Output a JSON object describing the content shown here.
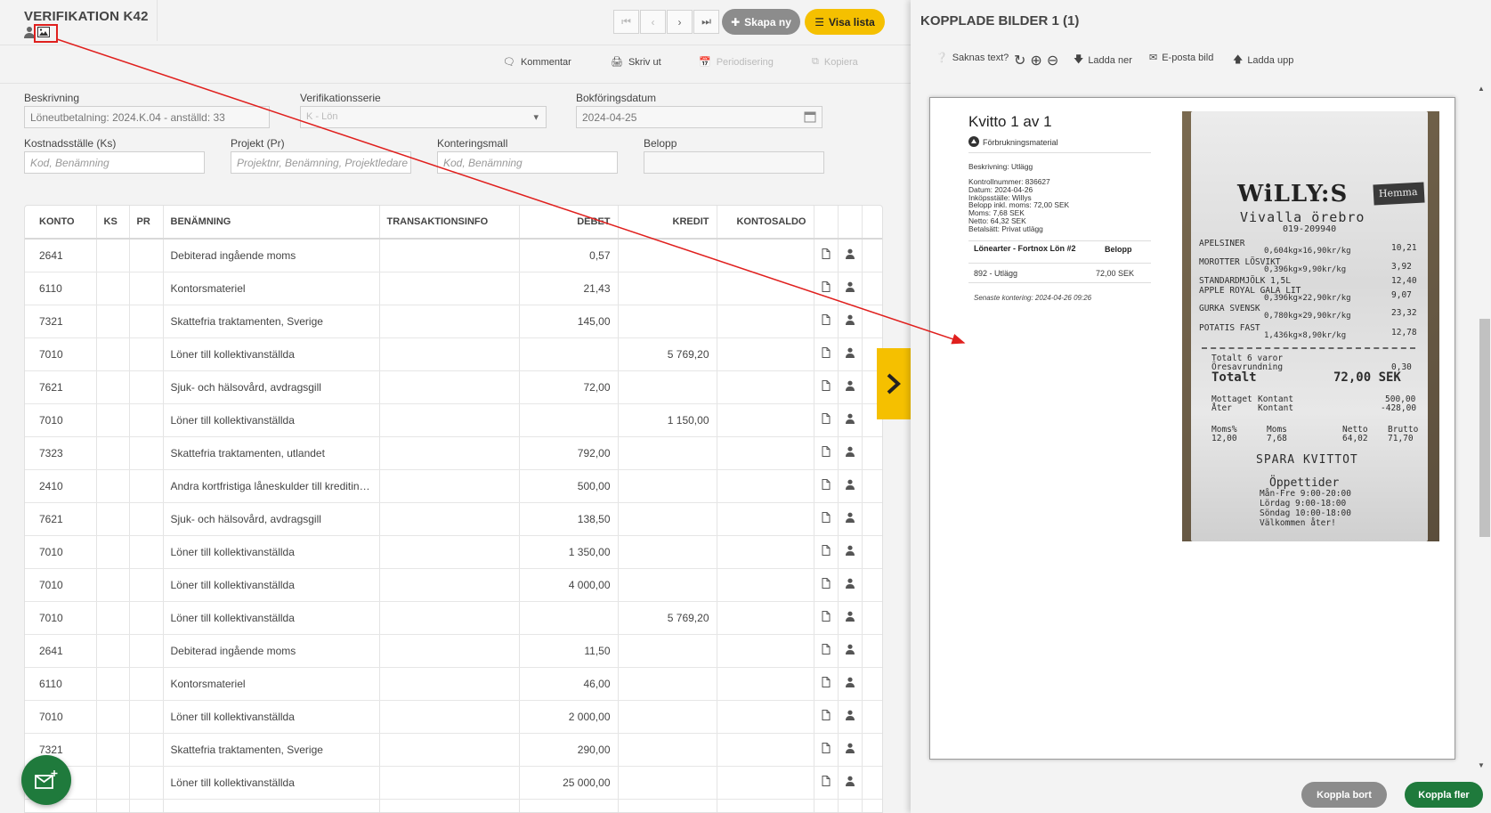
{
  "header": {
    "title": "VERIFIKATION K42",
    "skapa_label": "Skapa ny",
    "visa_label": "Visa lista"
  },
  "actions": {
    "kommentar": "Kommentar",
    "skriv_ut": "Skriv ut",
    "periodisering": "Periodisering",
    "kopiera": "Kopiera"
  },
  "form": {
    "beskrivning_label": "Beskrivning",
    "beskrivning_value": "Löneutbetalning: 2024.K.04 - anställd: 33",
    "serie_label": "Verifikationsserie",
    "serie_value": "K - Lön",
    "datum_label": "Bokföringsdatum",
    "datum_value": "2024-04-25",
    "ks_label": "Kostnadsställe (Ks)",
    "ks_placeholder": "Kod, Benämning",
    "pr_label": "Projekt (Pr)",
    "pr_placeholder": "Projektnr, Benämning, Projektledare",
    "mall_label": "Konteringsmall",
    "mall_placeholder": "Kod, Benämning",
    "belopp_label": "Belopp",
    "belopp_value": ""
  },
  "table": {
    "headers": [
      "KONTO",
      "KS",
      "PR",
      "BENÄMNING",
      "TRANSAKTIONSINFO",
      "DEBET",
      "KREDIT",
      "KONTOSALDO"
    ],
    "rows": [
      {
        "konto": "2641",
        "benamning": "Debiterad ingående moms",
        "debet": "0,57",
        "kredit": ""
      },
      {
        "konto": "6110",
        "benamning": "Kontorsmateriel",
        "debet": "21,43",
        "kredit": ""
      },
      {
        "konto": "7321",
        "benamning": "Skattefria traktamenten, Sverige",
        "debet": "145,00",
        "kredit": ""
      },
      {
        "konto": "7010",
        "benamning": "Löner till kollektivanställda",
        "debet": "",
        "kredit": "5 769,20"
      },
      {
        "konto": "7621",
        "benamning": "Sjuk- och hälsovård, avdragsgill",
        "debet": "72,00",
        "kredit": ""
      },
      {
        "konto": "7010",
        "benamning": "Löner till kollektivanställda",
        "debet": "",
        "kredit": "1 150,00"
      },
      {
        "konto": "7323",
        "benamning": "Skattefria traktamenten, utlandet",
        "debet": "792,00",
        "kredit": ""
      },
      {
        "konto": "2410",
        "benamning": "Andra kortfristiga låneskulder till kreditinstitut",
        "debet": "500,00",
        "kredit": ""
      },
      {
        "konto": "7621",
        "benamning": "Sjuk- och hälsovård, avdragsgill",
        "debet": "138,50",
        "kredit": ""
      },
      {
        "konto": "7010",
        "benamning": "Löner till kollektivanställda",
        "debet": "1 350,00",
        "kredit": ""
      },
      {
        "konto": "7010",
        "benamning": "Löner till kollektivanställda",
        "debet": "4 000,00",
        "kredit": ""
      },
      {
        "konto": "7010",
        "benamning": "Löner till kollektivanställda",
        "debet": "",
        "kredit": "5 769,20"
      },
      {
        "konto": "2641",
        "benamning": "Debiterad ingående moms",
        "debet": "11,50",
        "kredit": ""
      },
      {
        "konto": "6110",
        "benamning": "Kontorsmateriel",
        "debet": "46,00",
        "kredit": ""
      },
      {
        "konto": "7010",
        "benamning": "Löner till kollektivanställda",
        "debet": "2 000,00",
        "kredit": ""
      },
      {
        "konto": "7321",
        "benamning": "Skattefria traktamenten, Sverige",
        "debet": "290,00",
        "kredit": ""
      },
      {
        "konto": "",
        "benamning": "Löner till kollektivanställda",
        "debet": "25 000,00",
        "kredit": ""
      },
      {
        "konto": "",
        "benamning": "",
        "debet": "",
        "kredit": ""
      }
    ]
  },
  "right": {
    "title": "KOPPLADE BILDER 1 (1)",
    "saknas": "Saknas text?",
    "ladda_ner": "Ladda ner",
    "eposta": "E-posta bild",
    "ladda_upp": "Ladda upp",
    "koppla_bort": "Koppla bort",
    "koppla_fler": "Koppla fler"
  },
  "kvitto": {
    "title": "Kvitto 1 av 1",
    "category": "Förbrukningsmaterial",
    "beskrivning": "Beskrivning: Utlägg",
    "details": [
      "Kontrollnummer: 836627",
      "Datum: 2024-04-26",
      "Inköpsställe: Willys",
      "Belopp inkl. moms: 72,00 SEK",
      "Moms: 7,68 SEK",
      "Netto: 64,32 SEK",
      "Betalsätt: Privat utlägg"
    ],
    "col_left": "Lönearter - Fortnox Lön #2",
    "col_right": "Belopp",
    "row_left": "892 - Utlägg",
    "row_right": "72,00 SEK",
    "note": "Senaste kontering: 2024-04-26 09:26"
  },
  "receipt": {
    "store": "WiLLY:S",
    "store_tag": "Hemma",
    "location": "Vivalla örebro",
    "phone": "019-209940",
    "lines": [
      {
        "name": "APELSINER",
        "detail": "0,604kg×16,90kr/kg",
        "price": "10,21"
      },
      {
        "name": "MOROTTER LÖSVIKT",
        "detail": "0,396kg×9,90kr/kg",
        "price": "3,92"
      },
      {
        "name": "STANDARDMJÖLK 1,5L",
        "detail": "",
        "price": "12,40"
      },
      {
        "name": "APPLE ROYAL GALA LIT",
        "detail": "0,396kg×22,90kr/kg",
        "price": "9,07"
      },
      {
        "name": "GURKA SVENSK",
        "detail": "0,780kg×29,90kr/kg",
        "price": "23,32"
      },
      {
        "name": "POTATIS FAST",
        "detail": "1,436kg×8,90kr/kg",
        "price": "12,78"
      }
    ],
    "total_count": "Totalt 6 varor",
    "rounding_label": "Öresavrundning",
    "rounding": "0,30",
    "total_label": "Totalt",
    "total": "72,00 SEK",
    "mottaget_label": "Mottaget",
    "mottaget_type": "Kontant",
    "mottaget": "500,00",
    "ater_label": "Åter",
    "ater_type": "Kontant",
    "ater": "-428,00",
    "moms_head": [
      "Moms%",
      "Moms",
      "Netto",
      "Brutto"
    ],
    "moms_vals": [
      "12,00",
      "7,68",
      "64,02",
      "71,70"
    ],
    "spara": "SPARA KVITTOT",
    "oppettider": "Öppettider",
    "hours": [
      "Mån-Fre 9:00-20:00",
      "Lördag 9:00-18:00",
      "Söndag 10:00-18:00",
      "Välkommen åter!"
    ]
  },
  "colors": {
    "accent_yellow": "#f5c000",
    "primary_green": "#1f7a3c",
    "annotation_red": "#e0201e"
  }
}
